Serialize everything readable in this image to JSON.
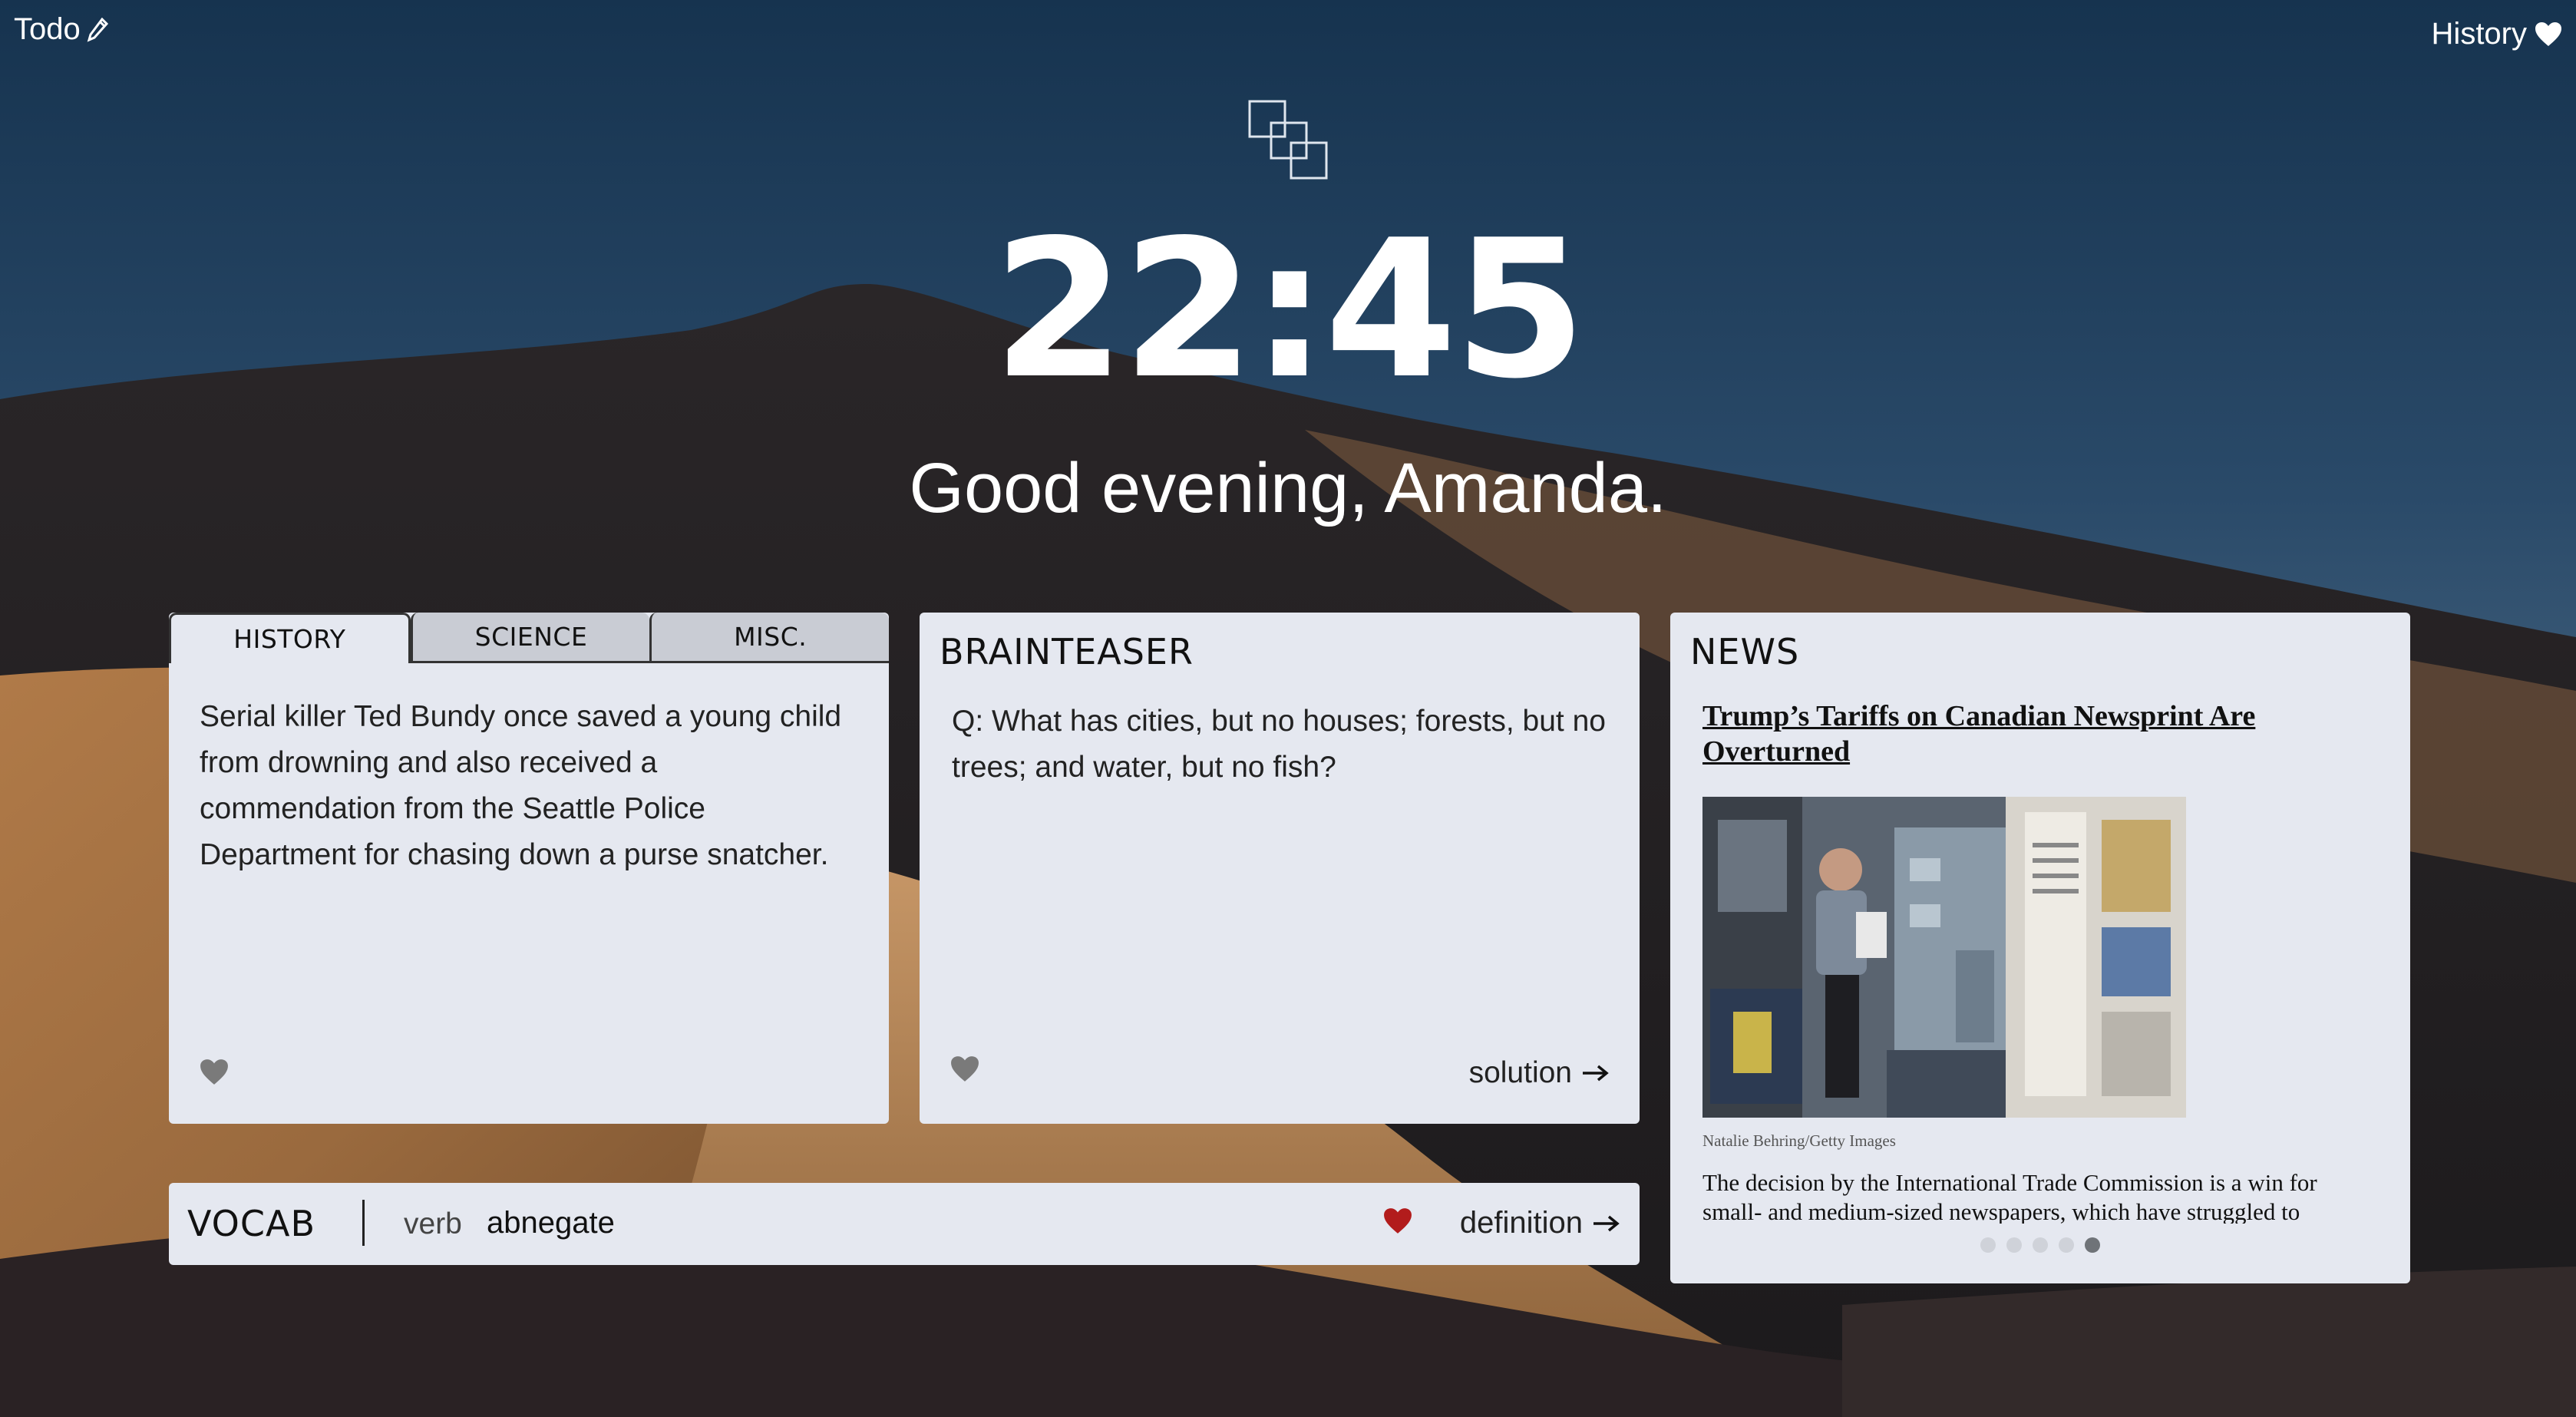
{
  "topbar": {
    "todo_label": "Todo",
    "todo_icon": "pencil-icon",
    "history_label": "History",
    "history_icon": "heart-icon"
  },
  "header": {
    "logo_icon": "stacked-squares-logo",
    "time": "22:45",
    "greeting": "Good evening, Amanda."
  },
  "facts": {
    "tabs": [
      {
        "label": "HISTORY",
        "active": true
      },
      {
        "label": "SCIENCE",
        "active": false
      },
      {
        "label": "MISC.",
        "active": false
      }
    ],
    "text": "Serial killer Ted Bundy once saved a young child from drowning and also received a commendation from the Seattle Police Department for chasing down a purse snatcher."
  },
  "brainteaser": {
    "title": "BRAINTEASER",
    "question": "Q: What has cities, but no houses; forests, but no trees; and water, but no fish?",
    "solution_label": "solution"
  },
  "news": {
    "title": "NEWS",
    "headline": "Trump’s Tariffs on Canadian Newsprint Are Overturned",
    "image_credit": "Natalie Behring/Getty Images",
    "summary": "The decision by the International Trade Commission is a win for small- and medium-sized newspapers, which have struggled to",
    "dots_total": 5,
    "dots_active": 5
  },
  "vocab": {
    "title": "VOCAB",
    "part_of_speech": "verb",
    "word": "abnegate",
    "definition_label": "definition"
  },
  "colors": {
    "card_bg": "#e5e8f0",
    "heart_gray": "#7a7a7a",
    "heart_red": "#b21c1c",
    "sky_top": "#1d3a5a"
  }
}
